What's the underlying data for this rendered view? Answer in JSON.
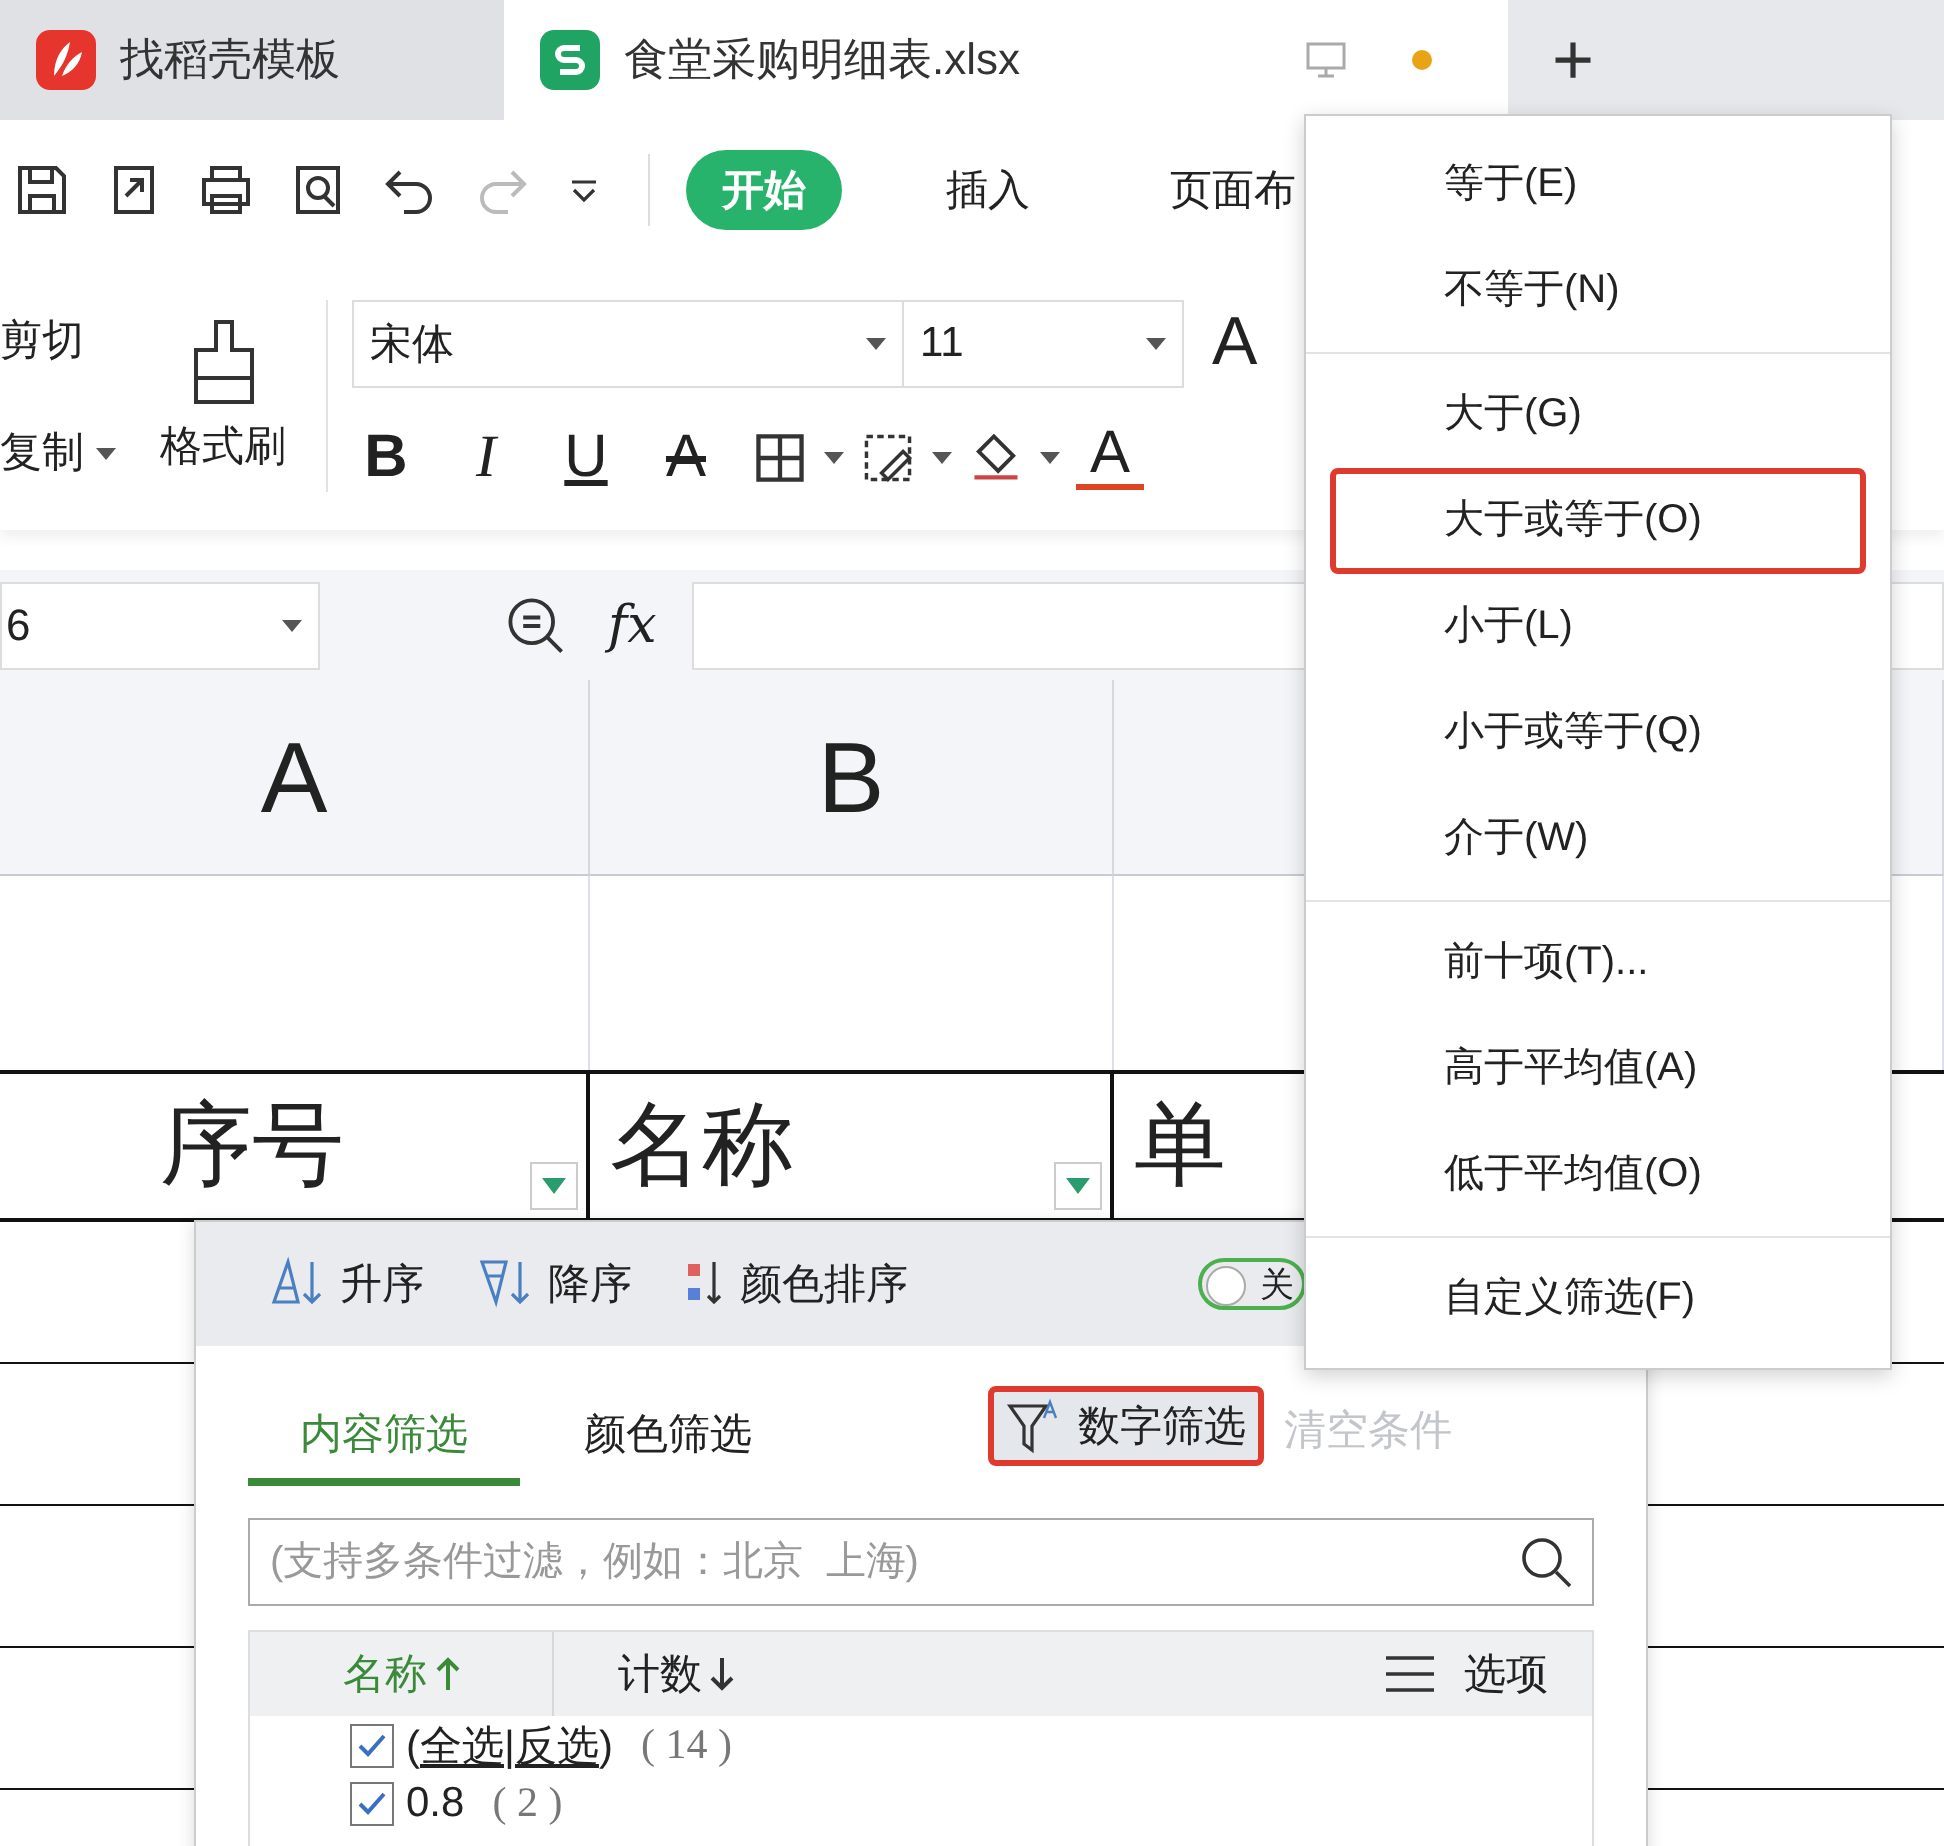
{
  "tabs": [
    {
      "label": "找稻壳模板",
      "selected": false,
      "kind": "docer"
    },
    {
      "label": "食堂采购明细表.xlsx",
      "selected": true,
      "kind": "sheet"
    }
  ],
  "new_tab": "+",
  "ribbon_tabs": [
    {
      "label": "开始",
      "selected": true
    },
    {
      "label": "插入",
      "selected": false
    },
    {
      "label": "页面布",
      "selected": false
    }
  ],
  "clipboard": {
    "cut": "剪切",
    "copy": "复制",
    "format_painter": "格式刷"
  },
  "font": {
    "name": "宋体",
    "size": "11",
    "grow": "A"
  },
  "format_buttons": [
    {
      "label": "B",
      "kind": "bold"
    },
    {
      "label": "I",
      "kind": "italic"
    },
    {
      "label": "U",
      "kind": "underline"
    },
    {
      "label": "A",
      "kind": "strike"
    }
  ],
  "font_color": "A",
  "name_box": "6",
  "formula_label": "fx",
  "columns": [
    "A",
    "B"
  ],
  "header_row": [
    {
      "text": "序号",
      "filter": true
    },
    {
      "text": "名称",
      "filter": true
    },
    {
      "text": "单",
      "filter": false
    }
  ],
  "filter_panel": {
    "sort": [
      {
        "label": "升序",
        "kind": "asc"
      },
      {
        "label": "降序",
        "kind": "desc"
      },
      {
        "label": "颜色排序",
        "kind": "color"
      }
    ],
    "toggle": {
      "label": "关",
      "on": false
    },
    "filter_tabs": [
      {
        "label": "内容筛选",
        "selected": true
      },
      {
        "label": "颜色筛选",
        "selected": false
      }
    ],
    "number_filter": {
      "label": "数字筛选",
      "highlighted": true
    },
    "clear": {
      "label": "清空条件",
      "disabled": true
    },
    "search": {
      "placeholder": "(支持多条件过滤，例如：北京  上海)"
    },
    "list_header": {
      "name": "名称",
      "count": "计数",
      "options": "选项"
    },
    "items": [
      {
        "kind": "all",
        "open": "(",
        "select_all": "全选",
        "sep": "|",
        "invert": "反选",
        "close": ")",
        "count": "( 14 )",
        "checked": true
      },
      {
        "kind": "value",
        "label": "0.8",
        "count": "( 2 )",
        "checked": true
      }
    ]
  },
  "menu": {
    "groups": [
      [
        {
          "label": "等于(E)",
          "highlighted": false
        },
        {
          "label": "不等于(N)",
          "highlighted": false
        }
      ],
      [
        {
          "label": "大于(G)",
          "highlighted": false
        },
        {
          "label": "大于或等于(O)",
          "highlighted": true
        },
        {
          "label": "小于(L)",
          "highlighted": false
        },
        {
          "label": "小于或等于(Q)",
          "highlighted": false
        },
        {
          "label": "介于(W)",
          "highlighted": false
        }
      ],
      [
        {
          "label": "前十项(T)...",
          "highlighted": false
        },
        {
          "label": "高于平均值(A)",
          "highlighted": false
        },
        {
          "label": "低于平均值(O)",
          "highlighted": false
        }
      ],
      [
        {
          "label": "自定义筛选(F)",
          "highlighted": false
        }
      ]
    ]
  }
}
